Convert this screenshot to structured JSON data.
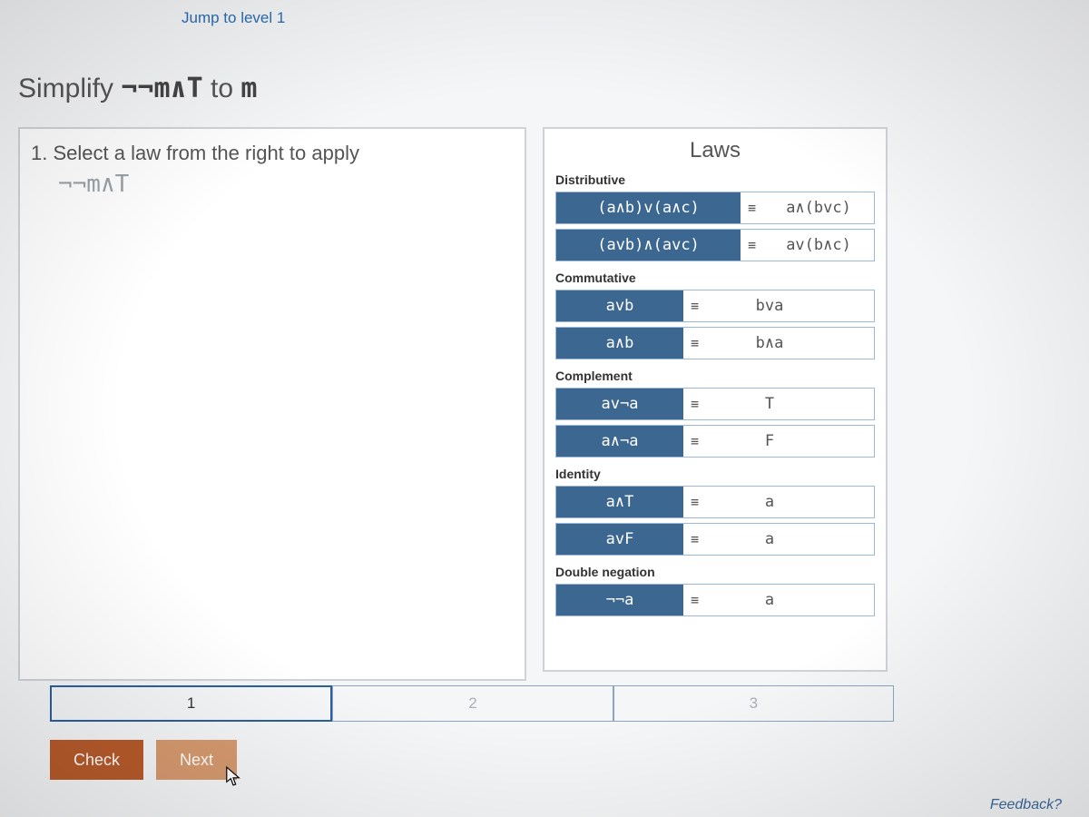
{
  "jump_link": "Jump to level 1",
  "title_prefix": "Simplify ",
  "title_expr": "¬¬m∧T",
  "title_mid": " to ",
  "title_target": "m",
  "instruction": "1. Select a law from the right to apply",
  "current_expr": "¬¬m∧T",
  "laws_header": "Laws",
  "sections": {
    "distributive": "Distributive",
    "commutative": "Commutative",
    "complement": "Complement",
    "identity": "Identity",
    "double_negation": "Double negation"
  },
  "laws": {
    "dist1": {
      "lhs": "(a∧b)v(a∧c)",
      "eq": "≡",
      "rhs": "a∧(bvc)"
    },
    "dist2": {
      "lhs": "(avb)∧(avc)",
      "eq": "≡",
      "rhs": "av(b∧c)"
    },
    "comm1": {
      "lhs": "avb",
      "eq": "≡",
      "rhs": "bva"
    },
    "comm2": {
      "lhs": "a∧b",
      "eq": "≡",
      "rhs": "b∧a"
    },
    "comp1": {
      "lhs": "av¬a",
      "eq": "≡",
      "rhs": "T"
    },
    "comp2": {
      "lhs": "a∧¬a",
      "eq": "≡",
      "rhs": "F"
    },
    "id1": {
      "lhs": "a∧T",
      "eq": "≡",
      "rhs": "a"
    },
    "id2": {
      "lhs": "avF",
      "eq": "≡",
      "rhs": "a"
    },
    "dn": {
      "lhs": "¬¬a",
      "eq": "≡",
      "rhs": "a"
    }
  },
  "steps": {
    "s1": "1",
    "s2": "2",
    "s3": "3"
  },
  "buttons": {
    "check": "Check",
    "next": "Next"
  },
  "feedback": "Feedback?"
}
